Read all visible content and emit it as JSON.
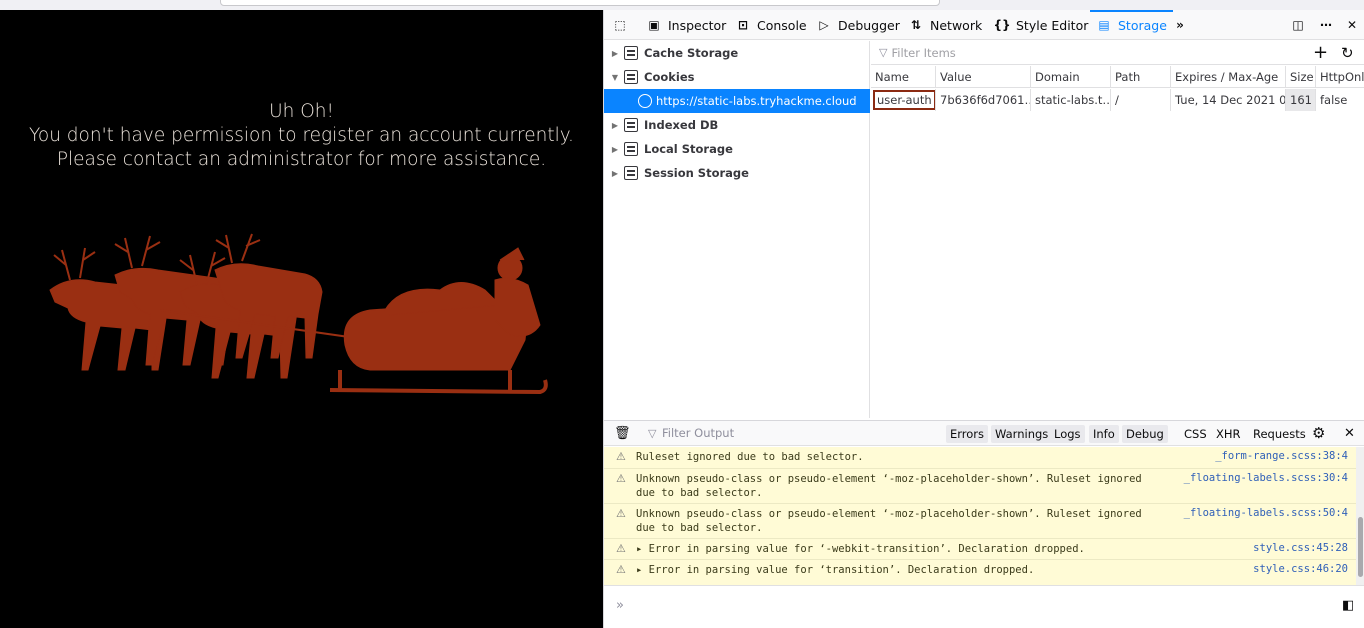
{
  "page": {
    "line1": "Uh Oh!",
    "line2": "You don't have permission to register an account currently.",
    "line3": "Please contact an administrator for more assistance."
  },
  "devtools": {
    "tabs": [
      {
        "label": "Inspector",
        "icon": "inspector-icon"
      },
      {
        "label": "Console",
        "icon": "console-icon"
      },
      {
        "label": "Debugger",
        "icon": "debugger-icon"
      },
      {
        "label": "Network",
        "icon": "network-icon"
      },
      {
        "label": "Style Editor",
        "icon": "style-editor-icon"
      },
      {
        "label": "Storage",
        "icon": "storage-icon",
        "active": true
      }
    ],
    "storage_tree": [
      {
        "label": "Cache Storage"
      },
      {
        "label": "Cookies",
        "expanded": true
      },
      {
        "label": "https://static-labs.tryhackme.cloud",
        "selected": true
      },
      {
        "label": "Indexed DB"
      },
      {
        "label": "Local Storage"
      },
      {
        "label": "Session Storage"
      }
    ],
    "filter_placeholder": "Filter Items",
    "columns": [
      "Name",
      "Value",
      "Domain",
      "Path",
      "Expires / Max-Age",
      "Size",
      "HttpOnly"
    ],
    "rows": [
      {
        "name": "user-auth",
        "value": "7b636f6d7061…",
        "domain": "static-labs.t…",
        "path": "/",
        "expires": "Tue, 14 Dec 2021 0…",
        "size": "161",
        "httponly": "false"
      }
    ],
    "console": {
      "filter_placeholder": "Filter Output",
      "levels": [
        "Errors",
        "Warnings",
        "Logs",
        "Info",
        "Debug"
      ],
      "types": [
        "CSS",
        "XHR",
        "Requests"
      ],
      "messages": [
        {
          "text": "Ruleset ignored due to bad selector.",
          "source": "_form-range.scss:38:4"
        },
        {
          "text": "Unknown pseudo-class or pseudo-element ‘-moz-placeholder-shown’.  Ruleset ignored due to bad selector.",
          "source": "_floating-labels.scss:30:4"
        },
        {
          "text": "Unknown pseudo-class or pseudo-element ‘-moz-placeholder-shown’.  Ruleset ignored due to bad selector.",
          "source": "_floating-labels.scss:50:4"
        },
        {
          "text": "Error in parsing value for ‘-webkit-transition’.  Declaration dropped.",
          "source": "style.css:45:28"
        },
        {
          "text": "Error in parsing value for ‘transition’.  Declaration dropped.",
          "source": "style.css:46:20"
        }
      ]
    }
  },
  "colors": {
    "accent": "#0a84ff",
    "highlight_border": "#8b2a12",
    "warning_bg": "#fffbd6",
    "sleigh": "#9a2f12"
  }
}
